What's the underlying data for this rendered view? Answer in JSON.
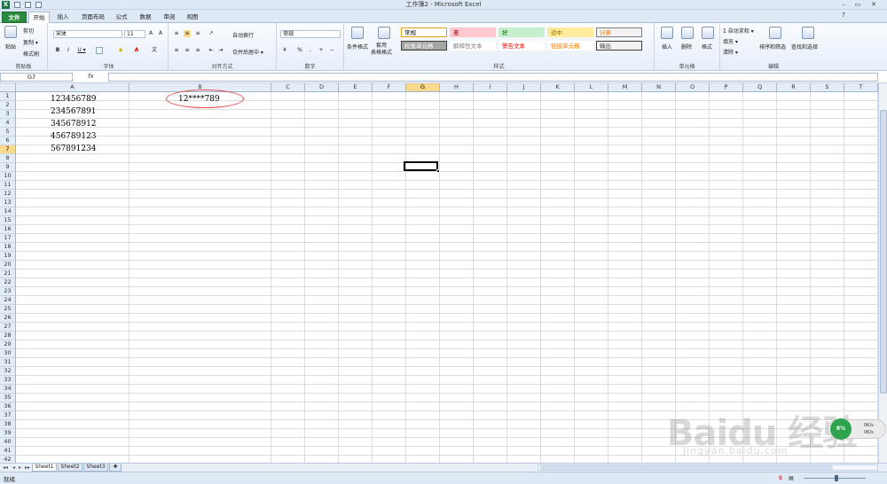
{
  "window": {
    "title": "工作簿2 - Microsoft Excel",
    "app_icon_letter": "X",
    "controls": {
      "minimize": "–",
      "restore": "▭",
      "close": "✕"
    }
  },
  "tabs": [
    {
      "label": "文件"
    },
    {
      "label": "开始"
    },
    {
      "label": "插入"
    },
    {
      "label": "页面布局"
    },
    {
      "label": "公式"
    },
    {
      "label": "数据"
    },
    {
      "label": "审阅"
    },
    {
      "label": "视图"
    }
  ],
  "ribbon": {
    "clipboard": {
      "label": "剪贴板",
      "paste": "粘贴",
      "cut": "剪切",
      "copy": "复制 ▾",
      "format_painter": "格式刷"
    },
    "font": {
      "label": "字体",
      "font_name": "宋体",
      "font_size": "11",
      "bold": "B",
      "italic": "I",
      "underline": "U ▾"
    },
    "alignment": {
      "label": "对齐方式",
      "wrap": "自动换行",
      "merge": "合并后居中 ▾"
    },
    "number": {
      "label": "数字",
      "format": "常规",
      "percent": "%",
      "comma": ","
    },
    "styles": {
      "label": "样式",
      "conditional": "条件格式",
      "table": "套用\n表格格式",
      "cells": [
        {
          "text": "常规",
          "bg": "#ffffff",
          "color": "#000000",
          "border": "#e1a317"
        },
        {
          "text": "差",
          "bg": "#ffc7ce",
          "color": "#9c0006",
          "border": "#ffc7ce"
        },
        {
          "text": "好",
          "bg": "#c6efce",
          "color": "#006100",
          "border": "#c6efce"
        },
        {
          "text": "适中",
          "bg": "#ffeb9c",
          "color": "#9c6500",
          "border": "#ffeb9c"
        },
        {
          "text": "计算",
          "bg": "#f2f2f2",
          "color": "#fa7d00",
          "border": "#7f7f7f"
        },
        {
          "text": "检查单元格",
          "bg": "#a5a5a5",
          "color": "#ffffff",
          "border": "#3f3f3f"
        },
        {
          "text": "解释性文本",
          "bg": "#ffffff",
          "color": "#7f7f7f",
          "border": "#ffffff"
        },
        {
          "text": "警告文本",
          "bg": "#ffffff",
          "color": "#ff0000",
          "border": "#ffffff"
        },
        {
          "text": "链接单元格",
          "bg": "#ffffff",
          "color": "#fa7d00",
          "border": "#ffffff"
        },
        {
          "text": "输出",
          "bg": "#f2f2f2",
          "color": "#3f3f3f",
          "border": "#3f3f3f"
        }
      ]
    },
    "cells": {
      "label": "单元格",
      "insert": "插入",
      "delete": "删除",
      "format": "格式"
    },
    "editing": {
      "label": "编辑",
      "autosum": "Σ 自动求和 ▾",
      "fill": "填充 ▾",
      "clear": "清除 ▾",
      "sort": "排序和筛选",
      "find": "查找和选择"
    }
  },
  "formula_bar": {
    "name_box": "G7",
    "fx": "fx",
    "content": ""
  },
  "columns": [
    "A",
    "B",
    "C",
    "D",
    "E",
    "F",
    "G",
    "H",
    "I",
    "J",
    "K",
    "L",
    "M",
    "N",
    "O",
    "P",
    "Q",
    "R",
    "S",
    "T"
  ],
  "selected_column": "G",
  "rows": [
    "1",
    "2",
    "3",
    "4",
    "5",
    "6",
    "7",
    "8",
    "9",
    "10",
    "11",
    "12",
    "13",
    "14",
    "15",
    "16",
    "17",
    "18",
    "19",
    "20",
    "21",
    "22",
    "23",
    "24",
    "25",
    "26",
    "27",
    "28",
    "29",
    "30",
    "31",
    "32",
    "33",
    "34",
    "35",
    "36",
    "37",
    "38",
    "39",
    "40",
    "41",
    "42"
  ],
  "selected_row": "7",
  "cells": {
    "A1": "123456789",
    "A2": "234567891",
    "A3": "345678912",
    "A4": "456789123",
    "A5": "567891234",
    "B1": "12****789"
  },
  "sheets": [
    {
      "name": "Sheet1",
      "active": true
    },
    {
      "name": "Sheet2",
      "active": false
    },
    {
      "name": "Sheet3",
      "active": false
    }
  ],
  "status": {
    "text": "就绪"
  },
  "speed_widget": {
    "percent": "8%",
    "up": "0K/s",
    "down": "0K/s"
  },
  "watermark": {
    "main": "Baidu 经验",
    "sub": "jingyan.baidu.com"
  },
  "accent": {
    "file_tab": "#2a8a3e",
    "selection": "#f9d98a",
    "annotation": "#e0474c"
  }
}
